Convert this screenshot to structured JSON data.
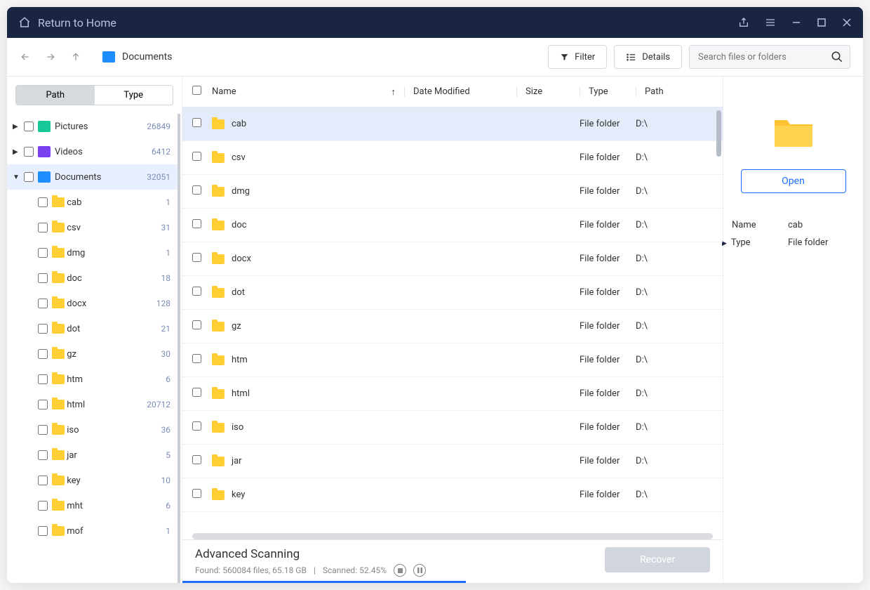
{
  "titlebar": {
    "home_label": "Return to Home"
  },
  "toolbar": {
    "breadcrumb": "Documents",
    "filter_label": "Filter",
    "details_label": "Details",
    "search_placeholder": "Search files or folders"
  },
  "sidebar": {
    "seg": {
      "path": "Path",
      "type": "Type"
    },
    "categories": [
      {
        "label": "Pictures",
        "count": "26849",
        "icon": "pic"
      },
      {
        "label": "Videos",
        "count": "6412",
        "icon": "vid"
      },
      {
        "label": "Documents",
        "count": "32051",
        "icon": "doc",
        "selected": true,
        "expanded": true
      }
    ],
    "doc_children": [
      {
        "label": "cab",
        "count": "1"
      },
      {
        "label": "csv",
        "count": "31"
      },
      {
        "label": "dmg",
        "count": "1"
      },
      {
        "label": "doc",
        "count": "18"
      },
      {
        "label": "docx",
        "count": "128"
      },
      {
        "label": "dot",
        "count": "21"
      },
      {
        "label": "gz",
        "count": "30"
      },
      {
        "label": "htm",
        "count": "6"
      },
      {
        "label": "html",
        "count": "20712"
      },
      {
        "label": "iso",
        "count": "36"
      },
      {
        "label": "jar",
        "count": "5"
      },
      {
        "label": "key",
        "count": "10"
      },
      {
        "label": "mht",
        "count": "6"
      },
      {
        "label": "mof",
        "count": "1"
      }
    ]
  },
  "table": {
    "cols": {
      "name": "Name",
      "date": "Date Modified",
      "size": "Size",
      "type": "Type",
      "path": "Path"
    },
    "rows": [
      {
        "name": "cab",
        "type": "File folder",
        "path": "D:\\",
        "selected": true
      },
      {
        "name": "csv",
        "type": "File folder",
        "path": "D:\\"
      },
      {
        "name": "dmg",
        "type": "File folder",
        "path": "D:\\"
      },
      {
        "name": "doc",
        "type": "File folder",
        "path": "D:\\"
      },
      {
        "name": "docx",
        "type": "File folder",
        "path": "D:\\"
      },
      {
        "name": "dot",
        "type": "File folder",
        "path": "D:\\"
      },
      {
        "name": "gz",
        "type": "File folder",
        "path": "D:\\"
      },
      {
        "name": "htm",
        "type": "File folder",
        "path": "D:\\"
      },
      {
        "name": "html",
        "type": "File folder",
        "path": "D:\\"
      },
      {
        "name": "iso",
        "type": "File folder",
        "path": "D:\\"
      },
      {
        "name": "jar",
        "type": "File folder",
        "path": "D:\\"
      },
      {
        "name": "key",
        "type": "File folder",
        "path": "D:\\"
      }
    ]
  },
  "preview": {
    "open_label": "Open",
    "name_label": "Name",
    "name_value": "cab",
    "type_label": "Type",
    "type_value": "File folder"
  },
  "status": {
    "title": "Advanced Scanning",
    "found_label": "Found:",
    "found_value": "560084 files, 65.18 GB",
    "scanned_label": "Scanned:",
    "scanned_value": "52.45%",
    "progress_percent": 52.45,
    "recover_label": "Recover"
  }
}
